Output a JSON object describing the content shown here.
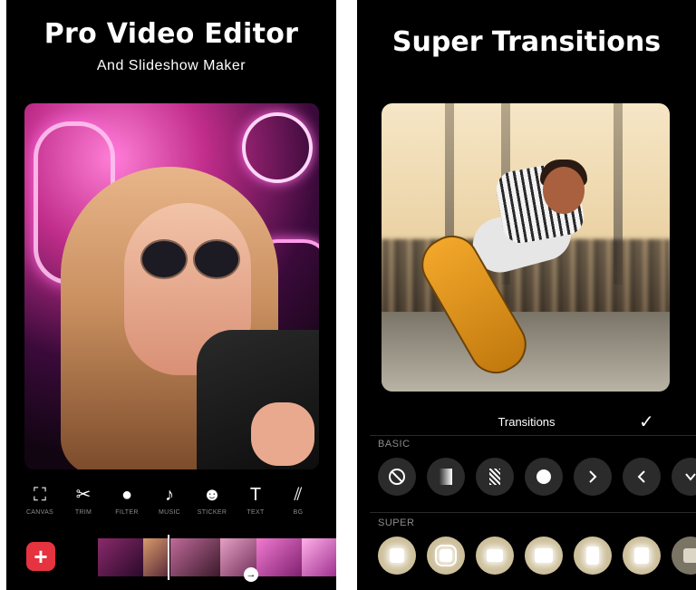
{
  "left": {
    "title": "Pro Video Editor",
    "subtitle": "And Slideshow Maker",
    "tools": [
      {
        "label": "CANVAS",
        "icon": "canvas-icon",
        "glyph": "⛶"
      },
      {
        "label": "TRIM",
        "icon": "scissors-icon",
        "glyph": "✂"
      },
      {
        "label": "FILTER",
        "icon": "filter-icon",
        "glyph": "●"
      },
      {
        "label": "MUSIC",
        "icon": "music-note-icon",
        "glyph": "♪"
      },
      {
        "label": "STICKER",
        "icon": "smiley-icon",
        "glyph": "☻"
      },
      {
        "label": "TEXT",
        "icon": "text-icon",
        "glyph": "T"
      },
      {
        "label": "BG",
        "icon": "background-stripes-icon",
        "glyph": "⫽"
      }
    ],
    "add_button": "+",
    "timeline_arrow": "→"
  },
  "right": {
    "title": "Super Transitions",
    "transitions_label": "Transitions",
    "confirm_glyph": "✓",
    "basic_label": "BASIC",
    "super_label": "SUPER",
    "basic_items": [
      {
        "icon": "none-icon",
        "glyph": "⃠"
      },
      {
        "icon": "fade-gradient-icon",
        "glyph": ""
      },
      {
        "icon": "dissolve-icon",
        "glyph": ""
      },
      {
        "icon": "circle-icon",
        "glyph": "●"
      },
      {
        "icon": "chevron-right-icon",
        "glyph": "›"
      },
      {
        "icon": "chevron-left-icon",
        "glyph": "‹"
      },
      {
        "icon": "chevron-down-icon",
        "glyph": "›"
      }
    ]
  },
  "colors": {
    "background": "#000000",
    "accent_red": "#e5333f",
    "super_tile": "#cdbf9a",
    "muted_label": "#8a8a8a"
  }
}
